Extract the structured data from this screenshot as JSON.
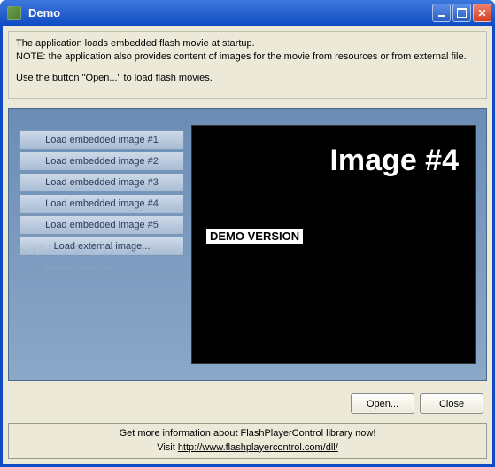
{
  "window": {
    "title": "Demo"
  },
  "info": {
    "line1": "The application loads embedded flash movie at startup.",
    "line2": "NOTE: the application also provides content of images for the movie from resources or from external file.",
    "line3": "Use the button \"Open...\" to load flash movies."
  },
  "buttons": {
    "items": [
      {
        "label": "Load embedded image #1"
      },
      {
        "label": "Load embedded image #2"
      },
      {
        "label": "Load embedded image #3"
      },
      {
        "label": "Load embedded image #4"
      },
      {
        "label": "Load embedded image #5"
      },
      {
        "label": "Load external image..."
      }
    ]
  },
  "flash": {
    "title": "Image #4",
    "demo": "DEMO VERSION"
  },
  "watermark": {
    "main": "SOFTPEDIA",
    "sub": "www.softpedia.com"
  },
  "actions": {
    "open": "Open...",
    "close": "Close"
  },
  "footer": {
    "line1": "Get more information about FlashPlayerControl library now!",
    "visit_prefix": "Visit ",
    "link": "http://www.flashplayercontrol.com/dll/"
  }
}
